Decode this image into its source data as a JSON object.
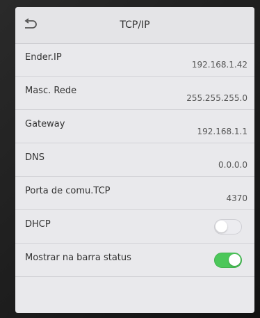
{
  "header": {
    "back_icon": "back-arrow-icon",
    "title": "TCP/IP"
  },
  "settings": [
    {
      "label": "Ender.IP",
      "value": "192.168.1.42"
    },
    {
      "label": "Masc. Rede",
      "value": "255.255.255.0"
    },
    {
      "label": "Gateway",
      "value": "192.168.1.1"
    },
    {
      "label": "DNS",
      "value": "0.0.0.0"
    },
    {
      "label": "Porta de comu.TCP",
      "value": "4370"
    }
  ],
  "toggles": [
    {
      "label": "DHCP",
      "state": "off"
    },
    {
      "label": "Mostrar na barra status",
      "state": "on"
    }
  ],
  "colors": {
    "toggle_on": "#4cc75a",
    "screen_bg": "#e9e9ec"
  }
}
